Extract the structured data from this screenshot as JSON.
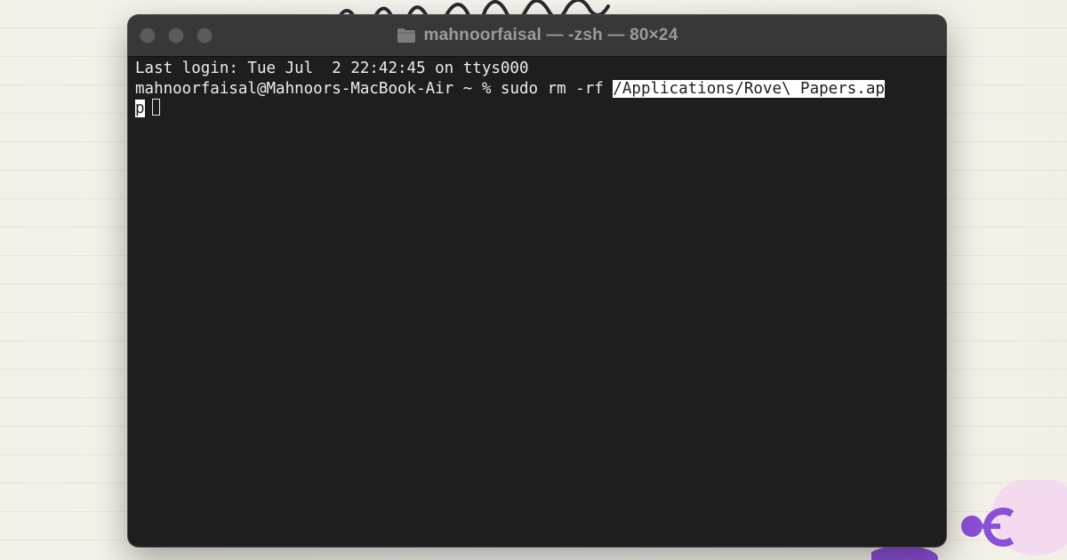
{
  "window": {
    "title": "mahnoorfaisal — -zsh — 80×24",
    "title_icon": "folder-icon"
  },
  "terminal": {
    "line1": "Last login: Tue Jul  2 22:42:45 on ttys000",
    "prompt": "mahnoorfaisal@Mahnoors-MacBook-Air ~ % ",
    "command": "sudo rm -rf ",
    "selected_path_part1": "/Applications/Rove\\ Papers.ap",
    "selected_path_part2": "p"
  },
  "colors": {
    "terminal_bg": "#1e1e1e",
    "titlebar_bg": "#383838",
    "text": "#ececec",
    "selection_bg": "#ffffff"
  }
}
